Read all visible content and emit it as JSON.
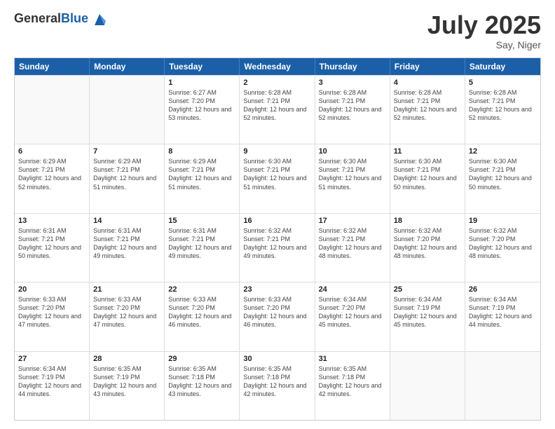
{
  "logo": {
    "general": "General",
    "blue": "Blue"
  },
  "header": {
    "month": "July 2025",
    "location": "Say, Niger"
  },
  "weekdays": [
    "Sunday",
    "Monday",
    "Tuesday",
    "Wednesday",
    "Thursday",
    "Friday",
    "Saturday"
  ],
  "weeks": [
    [
      {
        "day": "",
        "sunrise": "",
        "sunset": "",
        "daylight": ""
      },
      {
        "day": "",
        "sunrise": "",
        "sunset": "",
        "daylight": ""
      },
      {
        "day": "1",
        "sunrise": "Sunrise: 6:27 AM",
        "sunset": "Sunset: 7:20 PM",
        "daylight": "Daylight: 12 hours and 53 minutes."
      },
      {
        "day": "2",
        "sunrise": "Sunrise: 6:28 AM",
        "sunset": "Sunset: 7:21 PM",
        "daylight": "Daylight: 12 hours and 52 minutes."
      },
      {
        "day": "3",
        "sunrise": "Sunrise: 6:28 AM",
        "sunset": "Sunset: 7:21 PM",
        "daylight": "Daylight: 12 hours and 52 minutes."
      },
      {
        "day": "4",
        "sunrise": "Sunrise: 6:28 AM",
        "sunset": "Sunset: 7:21 PM",
        "daylight": "Daylight: 12 hours and 52 minutes."
      },
      {
        "day": "5",
        "sunrise": "Sunrise: 6:28 AM",
        "sunset": "Sunset: 7:21 PM",
        "daylight": "Daylight: 12 hours and 52 minutes."
      }
    ],
    [
      {
        "day": "6",
        "sunrise": "Sunrise: 6:29 AM",
        "sunset": "Sunset: 7:21 PM",
        "daylight": "Daylight: 12 hours and 52 minutes."
      },
      {
        "day": "7",
        "sunrise": "Sunrise: 6:29 AM",
        "sunset": "Sunset: 7:21 PM",
        "daylight": "Daylight: 12 hours and 51 minutes."
      },
      {
        "day": "8",
        "sunrise": "Sunrise: 6:29 AM",
        "sunset": "Sunset: 7:21 PM",
        "daylight": "Daylight: 12 hours and 51 minutes."
      },
      {
        "day": "9",
        "sunrise": "Sunrise: 6:30 AM",
        "sunset": "Sunset: 7:21 PM",
        "daylight": "Daylight: 12 hours and 51 minutes."
      },
      {
        "day": "10",
        "sunrise": "Sunrise: 6:30 AM",
        "sunset": "Sunset: 7:21 PM",
        "daylight": "Daylight: 12 hours and 51 minutes."
      },
      {
        "day": "11",
        "sunrise": "Sunrise: 6:30 AM",
        "sunset": "Sunset: 7:21 PM",
        "daylight": "Daylight: 12 hours and 50 minutes."
      },
      {
        "day": "12",
        "sunrise": "Sunrise: 6:30 AM",
        "sunset": "Sunset: 7:21 PM",
        "daylight": "Daylight: 12 hours and 50 minutes."
      }
    ],
    [
      {
        "day": "13",
        "sunrise": "Sunrise: 6:31 AM",
        "sunset": "Sunset: 7:21 PM",
        "daylight": "Daylight: 12 hours and 50 minutes."
      },
      {
        "day": "14",
        "sunrise": "Sunrise: 6:31 AM",
        "sunset": "Sunset: 7:21 PM",
        "daylight": "Daylight: 12 hours and 49 minutes."
      },
      {
        "day": "15",
        "sunrise": "Sunrise: 6:31 AM",
        "sunset": "Sunset: 7:21 PM",
        "daylight": "Daylight: 12 hours and 49 minutes."
      },
      {
        "day": "16",
        "sunrise": "Sunrise: 6:32 AM",
        "sunset": "Sunset: 7:21 PM",
        "daylight": "Daylight: 12 hours and 49 minutes."
      },
      {
        "day": "17",
        "sunrise": "Sunrise: 6:32 AM",
        "sunset": "Sunset: 7:21 PM",
        "daylight": "Daylight: 12 hours and 48 minutes."
      },
      {
        "day": "18",
        "sunrise": "Sunrise: 6:32 AM",
        "sunset": "Sunset: 7:20 PM",
        "daylight": "Daylight: 12 hours and 48 minutes."
      },
      {
        "day": "19",
        "sunrise": "Sunrise: 6:32 AM",
        "sunset": "Sunset: 7:20 PM",
        "daylight": "Daylight: 12 hours and 48 minutes."
      }
    ],
    [
      {
        "day": "20",
        "sunrise": "Sunrise: 6:33 AM",
        "sunset": "Sunset: 7:20 PM",
        "daylight": "Daylight: 12 hours and 47 minutes."
      },
      {
        "day": "21",
        "sunrise": "Sunrise: 6:33 AM",
        "sunset": "Sunset: 7:20 PM",
        "daylight": "Daylight: 12 hours and 47 minutes."
      },
      {
        "day": "22",
        "sunrise": "Sunrise: 6:33 AM",
        "sunset": "Sunset: 7:20 PM",
        "daylight": "Daylight: 12 hours and 46 minutes."
      },
      {
        "day": "23",
        "sunrise": "Sunrise: 6:33 AM",
        "sunset": "Sunset: 7:20 PM",
        "daylight": "Daylight: 12 hours and 46 minutes."
      },
      {
        "day": "24",
        "sunrise": "Sunrise: 6:34 AM",
        "sunset": "Sunset: 7:20 PM",
        "daylight": "Daylight: 12 hours and 45 minutes."
      },
      {
        "day": "25",
        "sunrise": "Sunrise: 6:34 AM",
        "sunset": "Sunset: 7:19 PM",
        "daylight": "Daylight: 12 hours and 45 minutes."
      },
      {
        "day": "26",
        "sunrise": "Sunrise: 6:34 AM",
        "sunset": "Sunset: 7:19 PM",
        "daylight": "Daylight: 12 hours and 44 minutes."
      }
    ],
    [
      {
        "day": "27",
        "sunrise": "Sunrise: 6:34 AM",
        "sunset": "Sunset: 7:19 PM",
        "daylight": "Daylight: 12 hours and 44 minutes."
      },
      {
        "day": "28",
        "sunrise": "Sunrise: 6:35 AM",
        "sunset": "Sunset: 7:19 PM",
        "daylight": "Daylight: 12 hours and 43 minutes."
      },
      {
        "day": "29",
        "sunrise": "Sunrise: 6:35 AM",
        "sunset": "Sunset: 7:18 PM",
        "daylight": "Daylight: 12 hours and 43 minutes."
      },
      {
        "day": "30",
        "sunrise": "Sunrise: 6:35 AM",
        "sunset": "Sunset: 7:18 PM",
        "daylight": "Daylight: 12 hours and 42 minutes."
      },
      {
        "day": "31",
        "sunrise": "Sunrise: 6:35 AM",
        "sunset": "Sunset: 7:18 PM",
        "daylight": "Daylight: 12 hours and 42 minutes."
      },
      {
        "day": "",
        "sunrise": "",
        "sunset": "",
        "daylight": ""
      },
      {
        "day": "",
        "sunrise": "",
        "sunset": "",
        "daylight": ""
      }
    ]
  ]
}
